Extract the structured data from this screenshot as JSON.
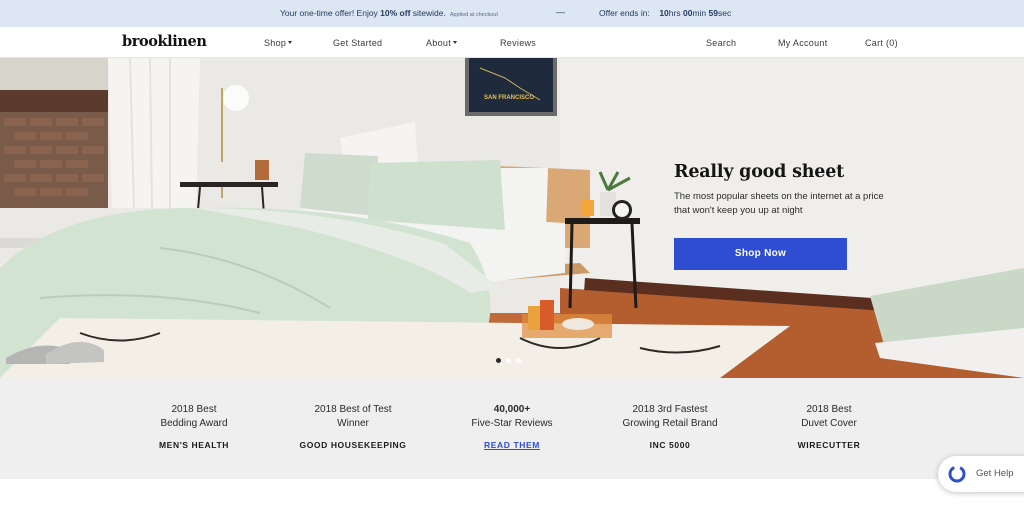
{
  "promo": {
    "offer_prefix": "Your one-time offer! Enjoy ",
    "offer_bold": "10% off",
    "offer_suffix": " sitewide.",
    "offer_note": "Applied at checkout",
    "separator": "—",
    "timer_label": "Offer ends in:",
    "hours_value": "10",
    "hours_unit": "hrs",
    "minutes_value": "00",
    "minutes_unit": "min",
    "seconds_value": "59",
    "seconds_unit": "sec"
  },
  "nav": {
    "logo": "brooklinen",
    "shop": "Shop",
    "get_started": "Get Started",
    "about": "About",
    "reviews": "Reviews",
    "search": "Search",
    "account": "My Account",
    "cart": "Cart (0)"
  },
  "hero": {
    "poster_text": "SAN FRANCISCO",
    "title": "Really good sheet",
    "subtitle": "The most popular sheets on the internet at a price that won't keep you up at night",
    "cta": "Shop Now",
    "slide_count": 3,
    "active_slide": 1
  },
  "awards": [
    {
      "line1": "2018 Best",
      "line2": "Bedding Award",
      "source": "MEN'S HEALTH"
    },
    {
      "line1": "2018 Best of Test",
      "line2": "Winner",
      "source": "GOOD HOUSEKEEPING"
    },
    {
      "line1": "40,000+",
      "line2": "Five-Star Reviews",
      "source": "READ THEM"
    },
    {
      "line1": "2018 3rd Fastest",
      "line2": "Growing Retail Brand",
      "source": "INC 5000"
    },
    {
      "line1": "2018 Best",
      "line2": "Duvet Cover",
      "source": "WIRECUTTER"
    }
  ],
  "help": {
    "label": "Get Help"
  },
  "colors": {
    "promo_bg": "#dde7f4",
    "accent_blue": "#2e4dd0",
    "awards_bg": "#efefef",
    "bedding_mint": "#cfe0cf"
  }
}
